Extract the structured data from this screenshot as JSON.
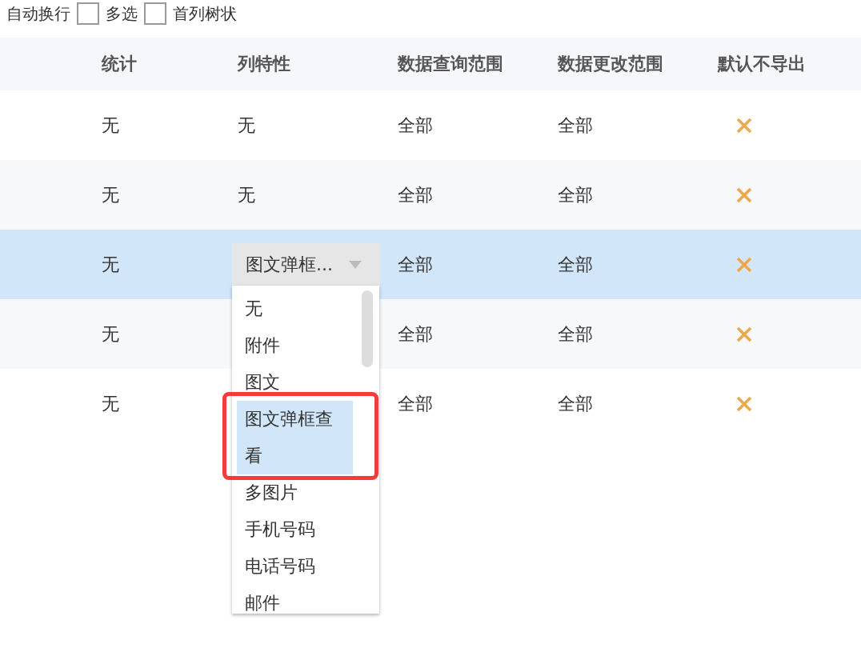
{
  "toolbar": {
    "options": [
      {
        "label": "自动换行",
        "checked": false
      },
      {
        "label": "多选",
        "checked": false
      },
      {
        "label": "首列树状"
      }
    ]
  },
  "table": {
    "columns": [
      "统计",
      "列特性",
      "数据查询范围",
      "数据更改范围",
      "默认不导出"
    ],
    "rows": [
      {
        "selected": false,
        "stat": "无",
        "feature": "无",
        "query": "全部",
        "edit": "全部",
        "no_export": false
      },
      {
        "selected": false,
        "stat": "无",
        "feature": "无",
        "query": "全部",
        "edit": "全部",
        "no_export": false
      },
      {
        "selected": true,
        "stat": "无",
        "feature": null,
        "query": "全部",
        "edit": "全部",
        "no_export": false,
        "editor": {
          "value": "图文弹框...",
          "options": [
            {
              "label": "无",
              "selected": false
            },
            {
              "label": "附件",
              "selected": false
            },
            {
              "label": "图文",
              "selected": false
            },
            {
              "label": "图文弹框查看",
              "selected": true
            },
            {
              "label": "多图片",
              "selected": false
            },
            {
              "label": "手机号码",
              "selected": false
            },
            {
              "label": "电话号码",
              "selected": false
            },
            {
              "label": "邮件",
              "selected": false
            }
          ]
        }
      },
      {
        "selected": false,
        "stat": "无",
        "feature": null,
        "query": "全部",
        "edit": "全部",
        "no_export": false
      },
      {
        "selected": false,
        "stat": "无",
        "feature": null,
        "query": "全部",
        "edit": "全部",
        "no_export": false
      }
    ]
  }
}
